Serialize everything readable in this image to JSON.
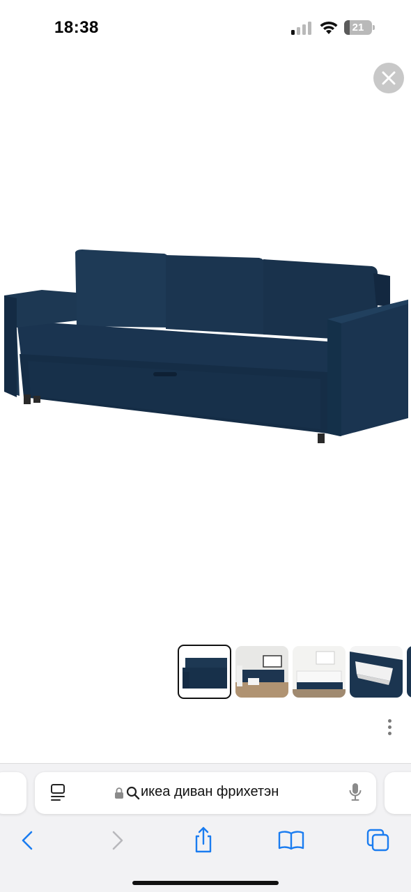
{
  "status_bar": {
    "time": "18:38",
    "battery_level": "21",
    "battery_fraction": 0.21,
    "icons": [
      "cellular-signal-icon",
      "wifi-icon",
      "battery-icon"
    ]
  },
  "viewer": {
    "close_icon": "close-icon",
    "product_image": "blue three-seat sofa bed",
    "thumbnails": [
      {
        "name": "sofa-front",
        "selected": true
      },
      {
        "name": "living-room-scene",
        "selected": false
      },
      {
        "name": "sofa-bed-open",
        "selected": false
      },
      {
        "name": "storage-detail",
        "selected": false
      }
    ],
    "more_icon": "more-vertical-icon"
  },
  "browser": {
    "address_text": "икеа диван фрихетэн",
    "icons": {
      "reader": "page-menu-icon",
      "lock": "lock-icon",
      "search": "search-icon",
      "mic": "microphone-icon"
    },
    "toolbar": [
      "back-icon",
      "forward-icon",
      "share-icon",
      "bookmarks-icon",
      "tabs-icon"
    ]
  },
  "colors": {
    "accent": "#1a7cf0",
    "sofa": "#1b3550",
    "chrome_bg": "#f2f2f4"
  }
}
